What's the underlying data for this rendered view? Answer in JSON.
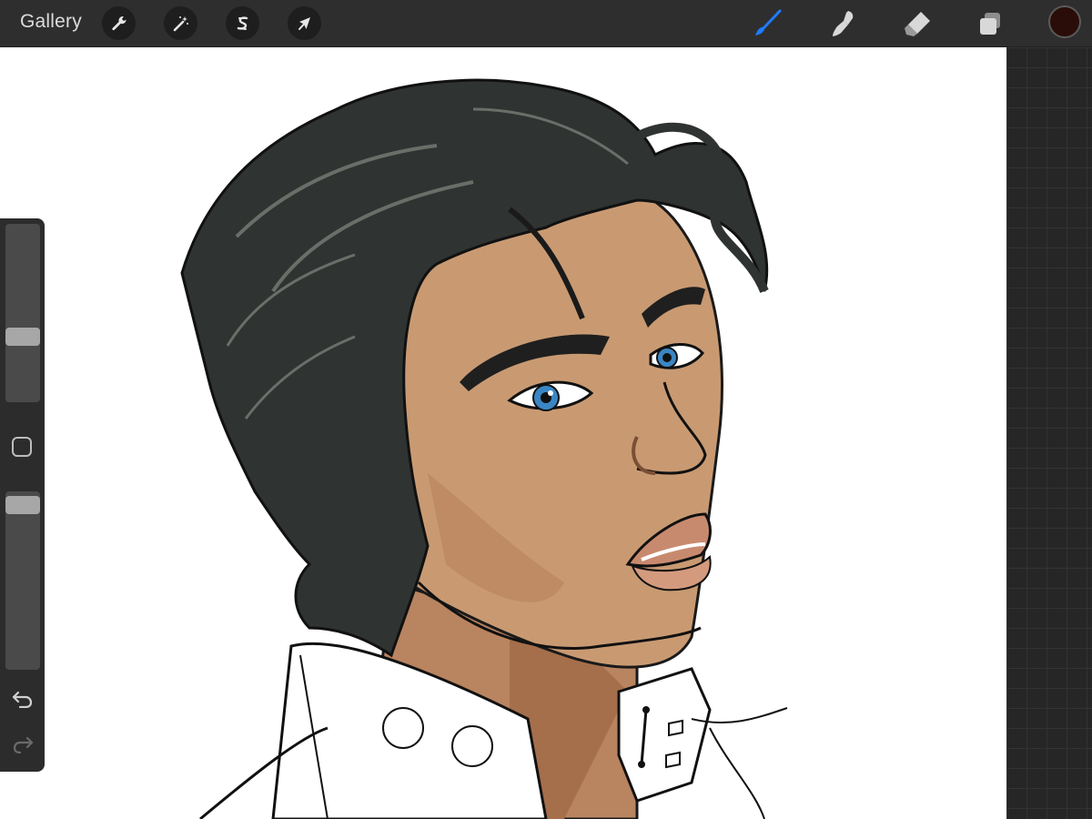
{
  "topbar": {
    "gallery_label": "Gallery",
    "left_tools": [
      {
        "name": "wrench-icon"
      },
      {
        "name": "magic-wand-icon"
      },
      {
        "name": "selection-s-icon"
      },
      {
        "name": "arrow-cursor-icon"
      }
    ],
    "right_tools": [
      {
        "name": "brush-icon",
        "active": true,
        "color": "#1e7bff"
      },
      {
        "name": "smudge-icon"
      },
      {
        "name": "eraser-icon"
      },
      {
        "name": "layers-icon"
      }
    ],
    "current_color": "#2a0d08"
  },
  "sidebar": {
    "brush_size_level": 0.35,
    "opacity_level": 0.97,
    "icons": [
      "modify-square-icon",
      "undo-icon",
      "redo-icon"
    ]
  },
  "colors": {
    "toolbar_bg": "#2e2e2e",
    "canvas_bg": "#ffffff",
    "workspace_bg": "#262626",
    "hair": "#2f3331",
    "skin": "#c99a72",
    "iris": "#3a86c4"
  }
}
